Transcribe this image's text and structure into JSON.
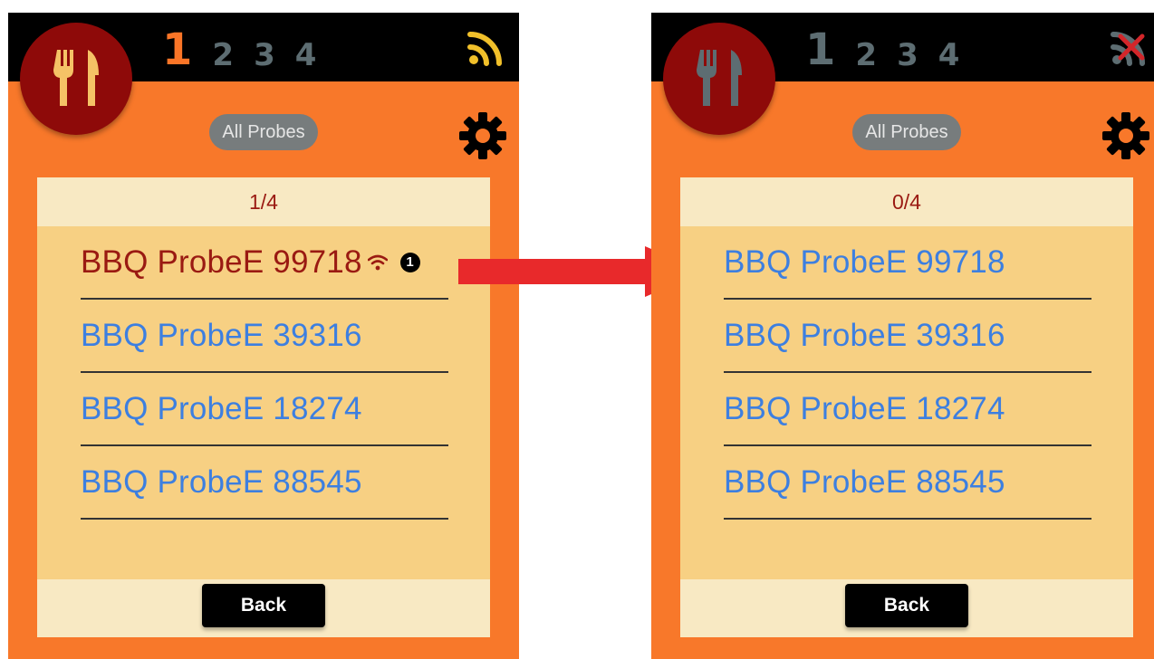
{
  "left_screen": {
    "tabs": [
      "1",
      "2",
      "3",
      "4"
    ],
    "active_tab": "1",
    "filter_label": "All Probes",
    "counter": "1/4",
    "probes": [
      {
        "label": "BBQ ProbeE 99718",
        "badge": "1"
      },
      {
        "label": "BBQ ProbeE 39316"
      },
      {
        "label": "BBQ ProbeE 18274"
      },
      {
        "label": "BBQ ProbeE 88545"
      }
    ],
    "back_label": "Back",
    "signal_icon": "wifi-signal-icon"
  },
  "right_screen": {
    "tabs": [
      "1",
      "2",
      "3",
      "4"
    ],
    "active_tab": "1",
    "filter_label": "All Probes",
    "counter": "0/4",
    "probes": [
      {
        "label": "BBQ ProbeE 99718"
      },
      {
        "label": "BBQ ProbeE 39316"
      },
      {
        "label": "BBQ ProbeE 18274"
      },
      {
        "label": "BBQ ProbeE 88545"
      }
    ],
    "back_label": "Back",
    "signal_icon": "signal-disconnected-icon"
  },
  "colors": {
    "background": "#f8782a",
    "topbar": "#000000",
    "logo_circle": "#8e0a09",
    "active_tab_left": "#fa7527",
    "tab_inactive": "#5d6d72",
    "panel": "#f7d083",
    "panel_header": "#f8e9c3",
    "probe_link": "#3d7fe0",
    "probe_selected": "#9a1a12",
    "arrow": "#e8292b"
  },
  "icons": {
    "logo": "fork-knife-icon",
    "settings": "gear-icon",
    "transition": "arrow-right-icon"
  }
}
